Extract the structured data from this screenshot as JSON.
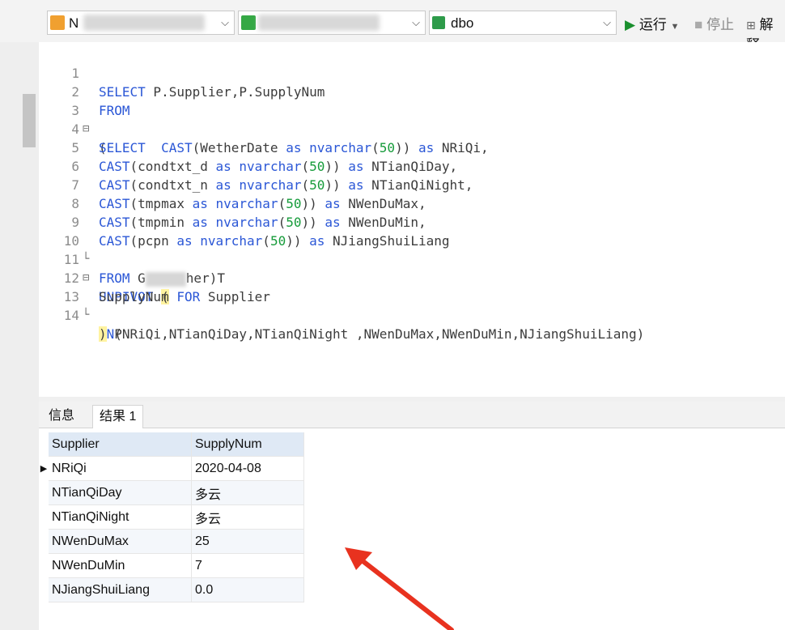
{
  "toolbar": {
    "conn_initial": "N",
    "schema": "dbo",
    "run_label": "运行",
    "stop_label": "停止",
    "explain_label": "解释"
  },
  "editor": {
    "lines": [
      {
        "n": "1",
        "t": "SELECT P.Supplier,P.SupplyNum"
      },
      {
        "n": "2",
        "t": "FROM"
      },
      {
        "n": "3",
        "t": "("
      },
      {
        "n": "4",
        "t": "SELECT  CAST(WetherDate as nvarchar(50)) as NRiQi,"
      },
      {
        "n": "5",
        "t": "CAST(condtxt_d as nvarchar(50)) as NTianQiDay,"
      },
      {
        "n": "6",
        "t": "CAST(condtxt_n as nvarchar(50)) as NTianQiNight,"
      },
      {
        "n": "7",
        "t": "CAST(tmpmax as nvarchar(50)) as NWenDuMax,"
      },
      {
        "n": "8",
        "t": "CAST(tmpmin as nvarchar(50)) as NWenDuMin,"
      },
      {
        "n": "9",
        "t": "CAST(pcpn as nvarchar(50)) as NJiangShuiLiang"
      },
      {
        "n": "10",
        "t": "FROM G     her)T"
      },
      {
        "n": "11",
        "t": "UNPIVOT ("
      },
      {
        "n": "12",
        "t": "SupplyNum FOR Supplier"
      },
      {
        "n": "13",
        "t": "IN(NRiQi,NTianQiDay,NTianQiNight ,NWenDuMax,NWenDuMin,NJiangShuiLiang)"
      },
      {
        "n": "14",
        "t": ") P"
      }
    ]
  },
  "tabs": {
    "info": "信息",
    "result1": "结果 1"
  },
  "grid": {
    "headers": [
      "Supplier",
      "SupplyNum"
    ],
    "rows": [
      [
        "NRiQi",
        "2020-04-08"
      ],
      [
        "NTianQiDay",
        "多云"
      ],
      [
        "NTianQiNight",
        "多云"
      ],
      [
        "NWenDuMax",
        "25"
      ],
      [
        "NWenDuMin",
        "7"
      ],
      [
        "NJiangShuiLiang",
        "0.0"
      ]
    ]
  },
  "colors": {
    "keyword": "#2b57d6",
    "number": "#169b3a",
    "arrow": "#e8321f"
  }
}
